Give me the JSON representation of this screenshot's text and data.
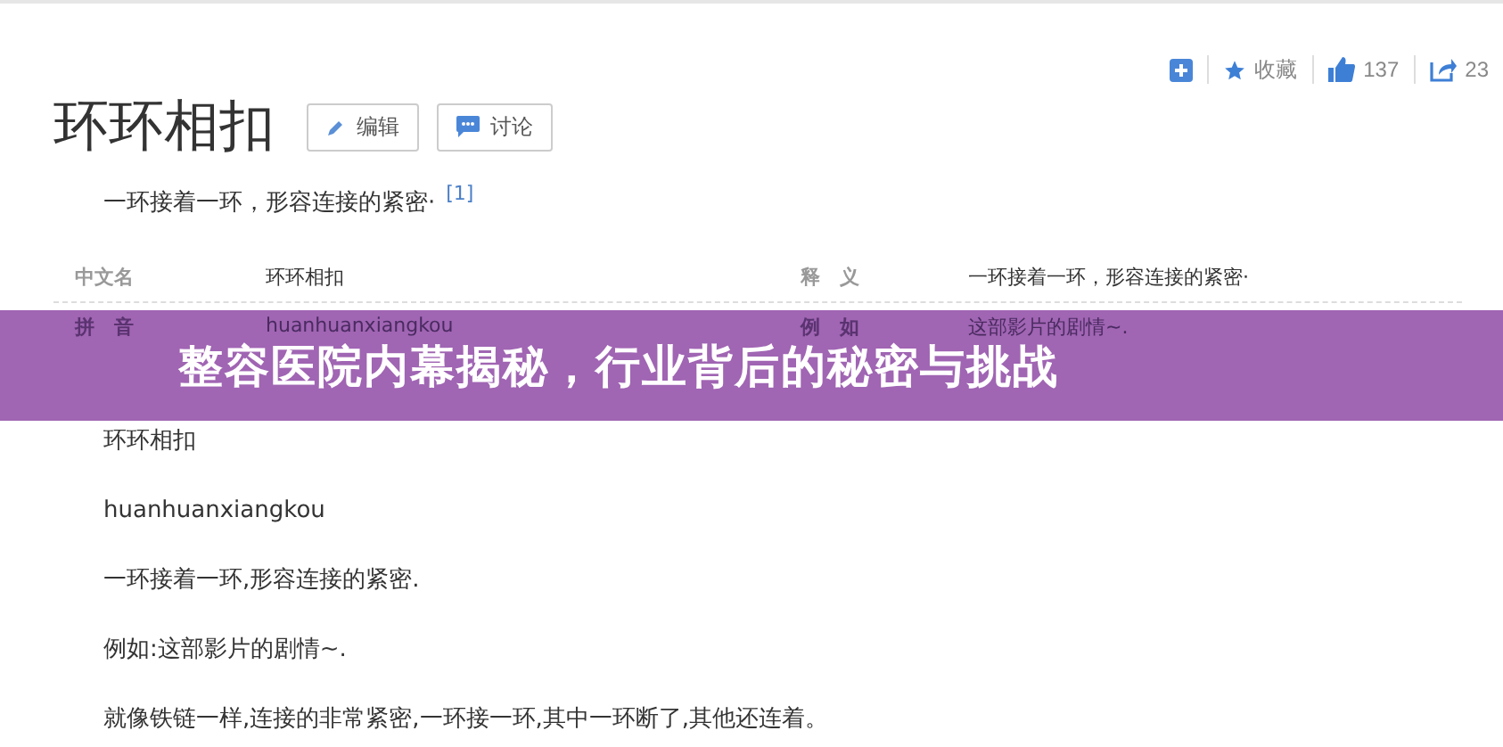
{
  "header": {
    "title": "环环相扣",
    "buttons": [
      {
        "kind": "edit",
        "label": "编辑"
      },
      {
        "kind": "discuss",
        "label": "讨论"
      }
    ]
  },
  "actions": [
    {
      "kind": "add"
    },
    {
      "kind": "star",
      "label": "收藏"
    },
    {
      "kind": "like",
      "label": "137"
    },
    {
      "kind": "share",
      "label": "23"
    }
  ],
  "summary": {
    "text": "一环接着一环，形容连接的紧密·",
    "footnote": "[1]"
  },
  "info_table": [
    {
      "label": "中文名",
      "value": "环环相扣",
      "label_2": "释　义",
      "value_2": "一环接着一环，形容连接的紧密·"
    },
    {
      "label": "拼　音",
      "value": "huanhuanxiangkou",
      "label_2": "例　如",
      "value_2": "这部影片的剧情~."
    }
  ],
  "banner": {
    "title": "整容医院内幕揭秘，行业背后的秘密与挑战"
  },
  "paragraphs": [
    "环环相扣",
    "huanhuanxiangkou",
    "一环接着一环,形容连接的紧密.",
    "例如:这部影片的剧情~.",
    "就像铁链一样,连接的非常紧密,一环接一环,其中一环断了,其他还连着。"
  ]
}
